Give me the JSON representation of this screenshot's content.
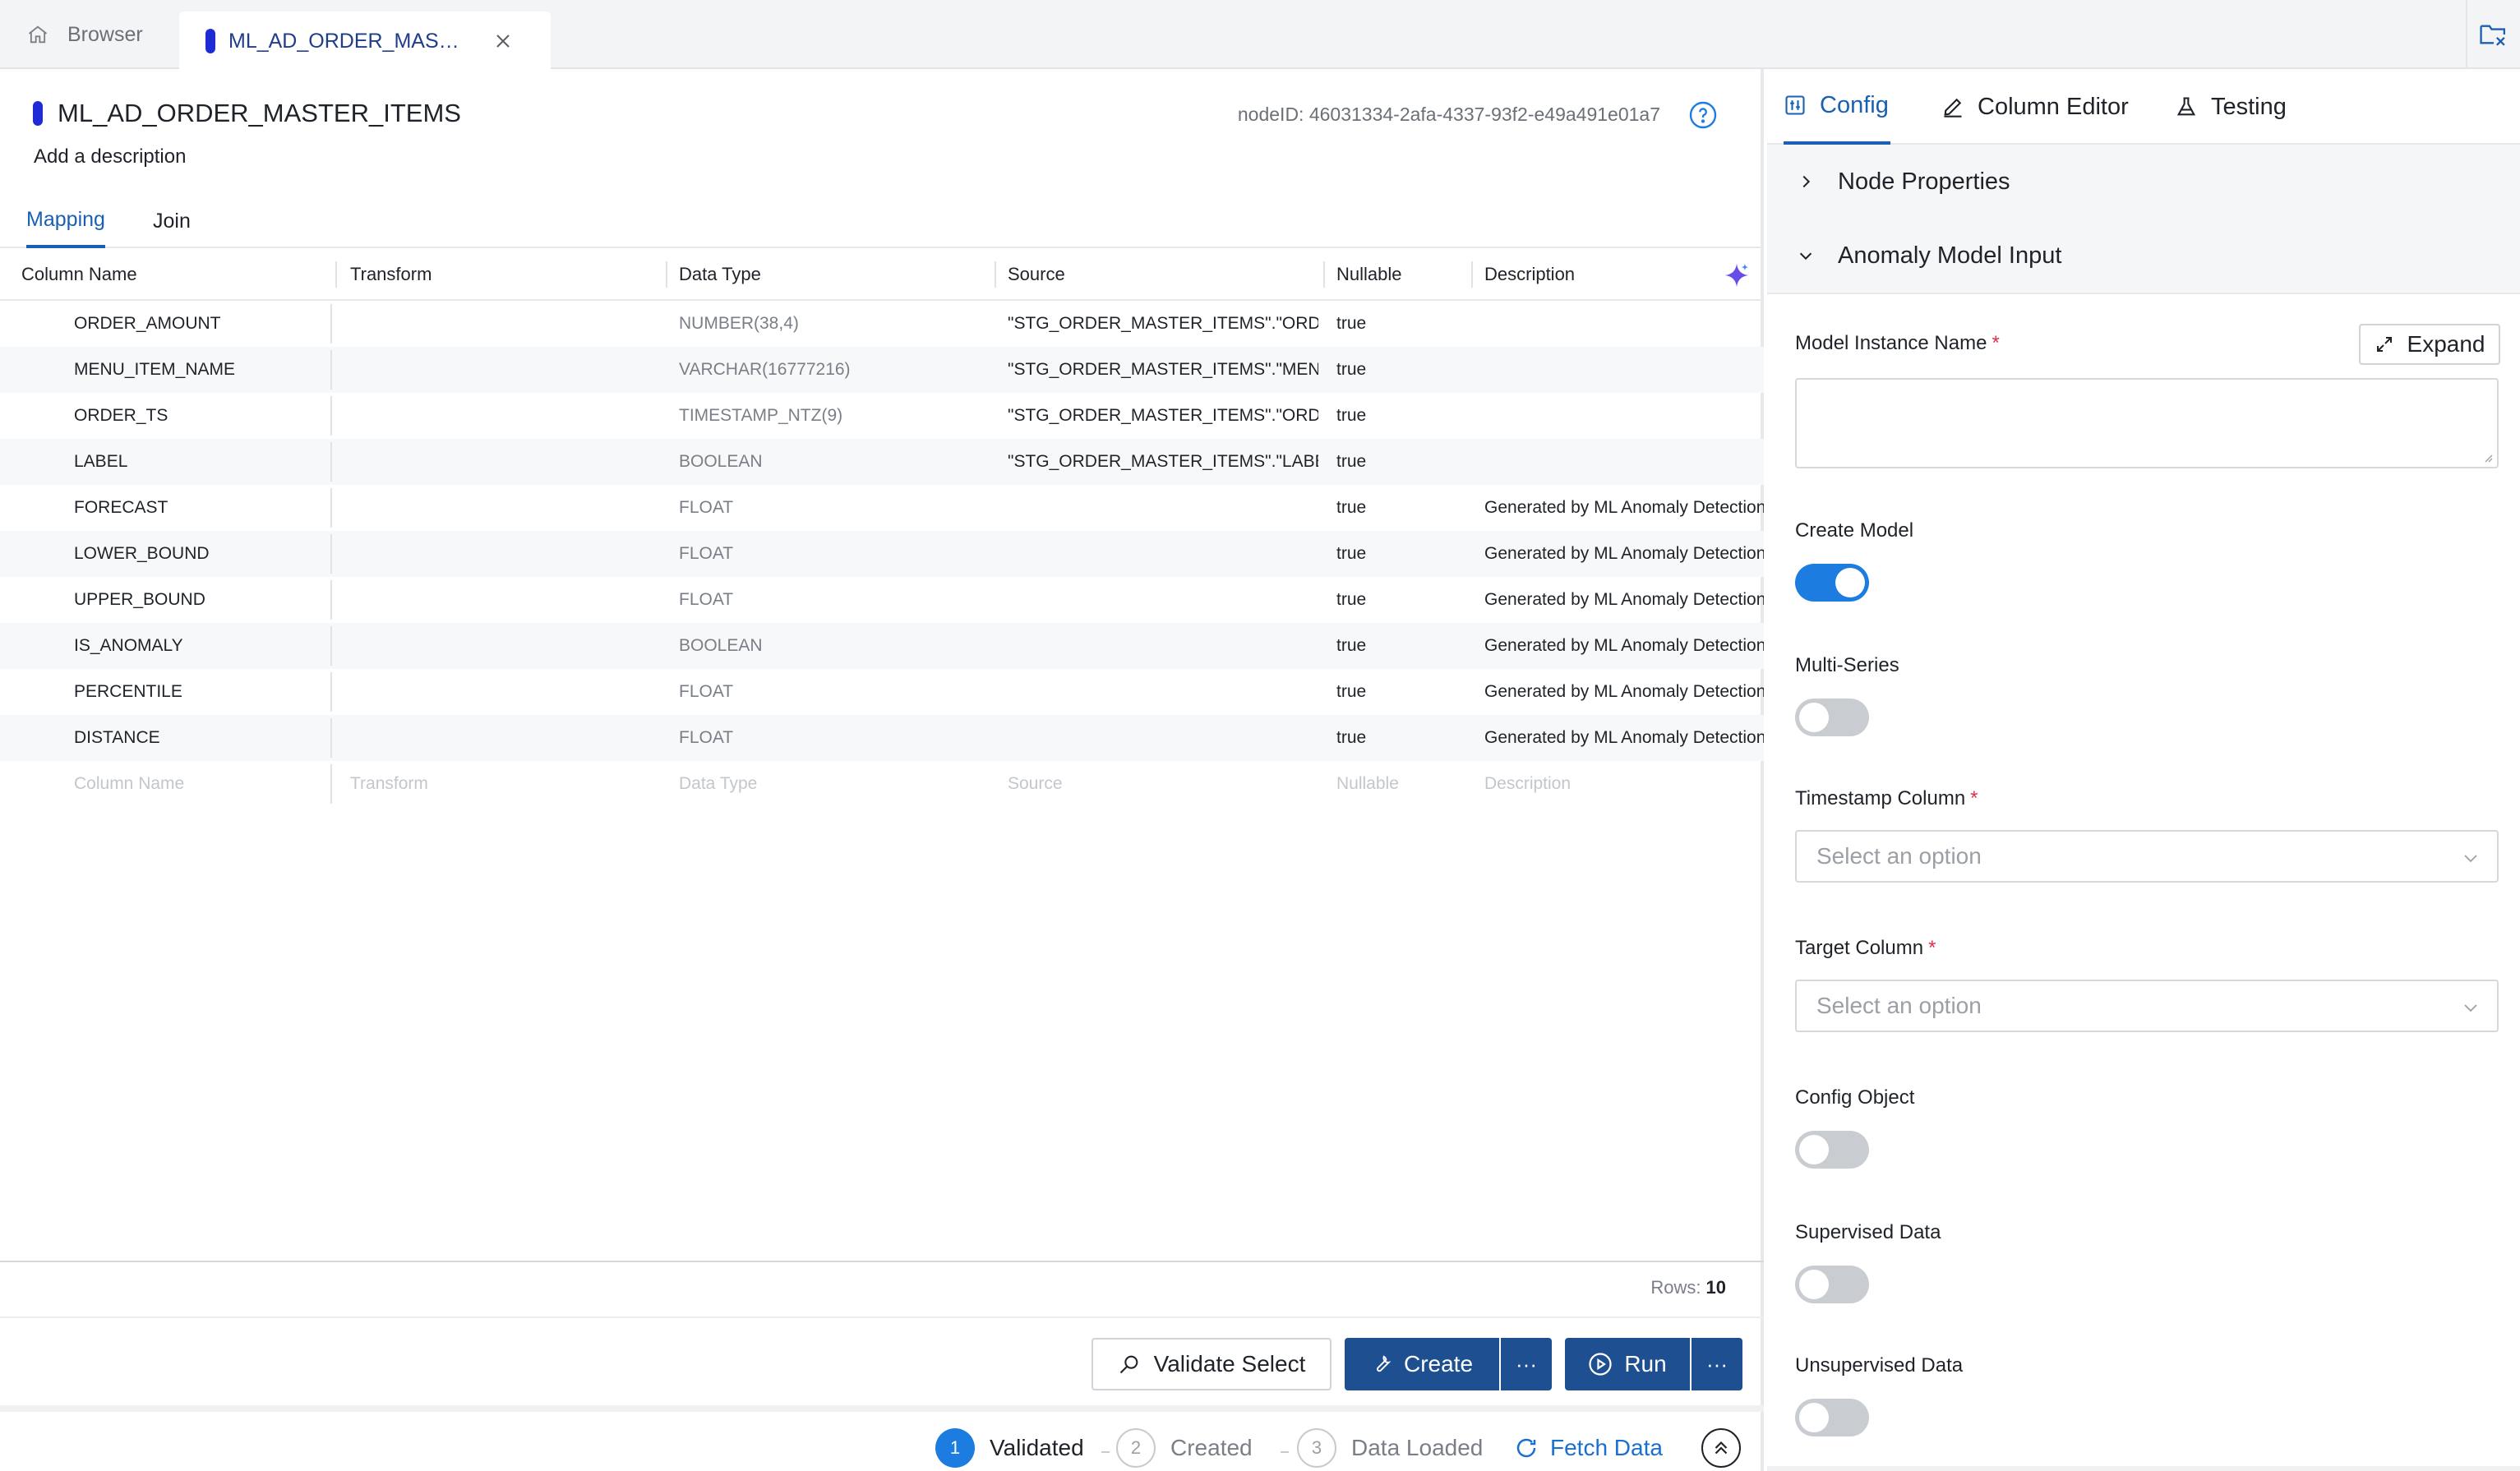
{
  "tabs": {
    "browser_label": "Browser",
    "node_label": "ML_AD_ORDER_MASTER_ITEMS"
  },
  "node": {
    "title": "ML_AD_ORDER_MASTER_ITEMS",
    "description_placeholder": "Add a description",
    "node_id": "nodeID: 46031334-2afa-4337-93f2-e49a491e01a7"
  },
  "subtabs": {
    "mapping": "Mapping",
    "join": "Join"
  },
  "grid": {
    "headers": {
      "column_name": "Column Name",
      "transform": "Transform",
      "data_type": "Data Type",
      "source": "Source",
      "nullable": "Nullable",
      "description": "Description"
    },
    "rows": [
      {
        "name": "ORDER_AMOUNT",
        "transform": "",
        "data_type": "NUMBER(38,4)",
        "source": "\"STG_ORDER_MASTER_ITEMS\".\"ORDER_AMOUNT\"",
        "nullable": "true",
        "description": ""
      },
      {
        "name": "MENU_ITEM_NAME",
        "transform": "",
        "data_type": "VARCHAR(16777216)",
        "source": "\"STG_ORDER_MASTER_ITEMS\".\"MENU_ITEM_NAME\"",
        "nullable": "true",
        "description": ""
      },
      {
        "name": "ORDER_TS",
        "transform": "",
        "data_type": "TIMESTAMP_NTZ(9)",
        "source": "\"STG_ORDER_MASTER_ITEMS\".\"ORDER_TS\"",
        "nullable": "true",
        "description": ""
      },
      {
        "name": "LABEL",
        "transform": "",
        "data_type": "BOOLEAN",
        "source": "\"STG_ORDER_MASTER_ITEMS\".\"LABEL\"",
        "nullable": "true",
        "description": ""
      },
      {
        "name": "FORECAST",
        "transform": "",
        "data_type": "FLOAT",
        "source": "",
        "nullable": "true",
        "description": "Generated by ML Anomaly Detection"
      },
      {
        "name": "LOWER_BOUND",
        "transform": "",
        "data_type": "FLOAT",
        "source": "",
        "nullable": "true",
        "description": "Generated by ML Anomaly Detection"
      },
      {
        "name": "UPPER_BOUND",
        "transform": "",
        "data_type": "FLOAT",
        "source": "",
        "nullable": "true",
        "description": "Generated by ML Anomaly Detection"
      },
      {
        "name": "IS_ANOMALY",
        "transform": "",
        "data_type": "BOOLEAN",
        "source": "",
        "nullable": "true",
        "description": "Generated by ML Anomaly Detection"
      },
      {
        "name": "PERCENTILE",
        "transform": "",
        "data_type": "FLOAT",
        "source": "",
        "nullable": "true",
        "description": "Generated by ML Anomaly Detection"
      },
      {
        "name": "DISTANCE",
        "transform": "",
        "data_type": "FLOAT",
        "source": "",
        "nullable": "true",
        "description": "Generated by ML Anomaly Detection"
      }
    ],
    "new_row_placeholders": {
      "column_name": "Column Name",
      "transform": "Transform",
      "data_type": "Data Type",
      "source": "Source",
      "nullable": "Nullable",
      "description": "Description"
    },
    "rows_label": "Rows:",
    "rows_count": "10"
  },
  "actions": {
    "validate_select": "Validate Select",
    "create": "Create",
    "run": "Run",
    "more": "···"
  },
  "status": {
    "steps": [
      {
        "num": "1",
        "label": "Validated",
        "state": "done"
      },
      {
        "num": "2",
        "label": "Created",
        "state": "todo"
      },
      {
        "num": "3",
        "label": "Data Loaded",
        "state": "todo"
      }
    ],
    "fetch_data": "Fetch Data"
  },
  "config_panel": {
    "tabs": {
      "config": "Config",
      "column_editor": "Column Editor",
      "testing": "Testing"
    },
    "sections": {
      "node_properties": "Node Properties",
      "anomaly_model_input": "Anomaly Model Input"
    },
    "required_marker": "*",
    "model_instance_name": {
      "label": "Model Instance Name",
      "value": "",
      "expand": "Expand"
    },
    "create_model": {
      "label": "Create Model",
      "on": true
    },
    "multi_series": {
      "label": "Multi-Series",
      "on": false
    },
    "timestamp_column": {
      "label": "Timestamp Column",
      "placeholder": "Select an option"
    },
    "target_column": {
      "label": "Target Column",
      "placeholder": "Select an option"
    },
    "config_object": {
      "label": "Config Object",
      "on": false
    },
    "supervised_data": {
      "label": "Supervised Data",
      "on": false
    },
    "unsupervised_data": {
      "label": "Unsupervised Data",
      "on": false
    }
  },
  "colors": {
    "accent": "#1a5fb4",
    "primary_button": "#1d4f91",
    "node_chip": "#1f2cd6",
    "toggle_on": "#1d7ce0",
    "required": "#e0304a"
  }
}
